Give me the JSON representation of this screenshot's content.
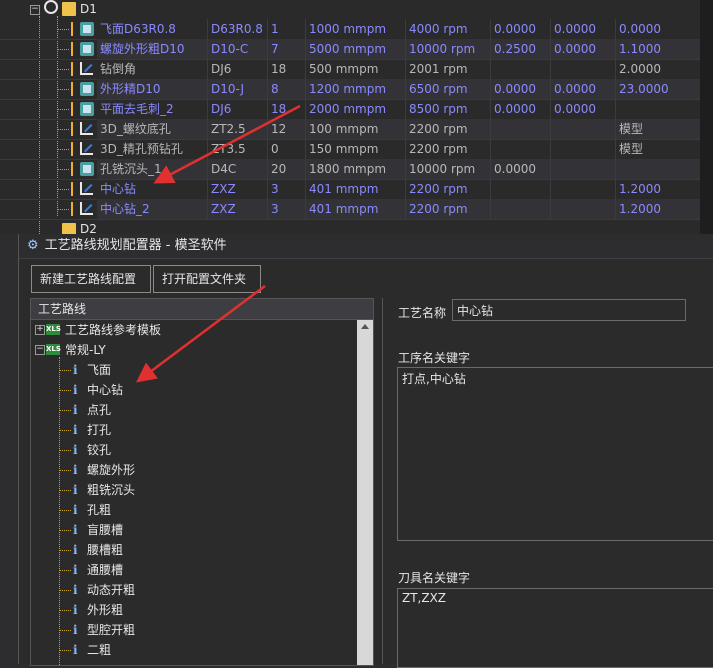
{
  "top": {
    "group_d1": "D1",
    "group_d2": "D2",
    "rows": [
      {
        "name": "飞面D63R0.8",
        "tool": "D63R0.8",
        "num": "1",
        "feed": "1000 mmpm",
        "speed": "4000 rpm",
        "v1": "0.0000",
        "v2": "0.0000",
        "v3": "0.0000",
        "style": "blue",
        "icon": "op"
      },
      {
        "name": "螺旋外形粗D10",
        "tool": "D10-C",
        "num": "7",
        "feed": "5000 mmpm",
        "speed": "10000 rpm",
        "v1": "0.2500",
        "v2": "0.0000",
        "v3": "1.1000",
        "style": "blue",
        "icon": "op"
      },
      {
        "name": "钻倒角",
        "tool": "DJ6",
        "num": "18",
        "feed": "500 mmpm",
        "speed": "2001 rpm",
        "v1": "",
        "v2": "",
        "v3": "2.0000",
        "style": "gray",
        "icon": "drill"
      },
      {
        "name": "外形精D10",
        "tool": "D10-J",
        "num": "8",
        "feed": "1200 mmpm",
        "speed": "6500 rpm",
        "v1": "0.0000",
        "v2": "0.0000",
        "v3": "23.0000",
        "style": "blue",
        "icon": "op"
      },
      {
        "name": "平面去毛刺_2",
        "tool": "DJ6",
        "num": "18",
        "feed": "2000 mmpm",
        "speed": "8500 rpm",
        "v1": "0.0000",
        "v2": "0.0000",
        "v3": "",
        "style": "blue",
        "icon": "op"
      },
      {
        "name": "3D_螺纹底孔",
        "tool": "ZT2.5",
        "num": "12",
        "feed": "100 mmpm",
        "speed": "2200 rpm",
        "v1": "",
        "v2": "",
        "v3": "模型",
        "style": "gray",
        "icon": "drill"
      },
      {
        "name": "3D_精孔预钻孔",
        "tool": "ZT3.5",
        "num": "0",
        "feed": "150 mmpm",
        "speed": "2200 rpm",
        "v1": "",
        "v2": "",
        "v3": "模型",
        "style": "gray",
        "icon": "drill"
      },
      {
        "name": "孔铣沉头_1",
        "tool": "D4C",
        "num": "20",
        "feed": "1800 mmpm",
        "speed": "10000 rpm",
        "v1": "0.0000",
        "v2": "",
        "v3": "",
        "style": "gray",
        "icon": "op2"
      },
      {
        "name": "中心钻",
        "tool": "ZXZ",
        "num": "3",
        "feed": "401 mmpm",
        "speed": "2200 rpm",
        "v1": "",
        "v2": "",
        "v3": "1.2000",
        "style": "blue",
        "icon": "drill"
      },
      {
        "name": "中心钻_2",
        "tool": "ZXZ",
        "num": "3",
        "feed": "401 mmpm",
        "speed": "2200 rpm",
        "v1": "",
        "v2": "",
        "v3": "1.2000",
        "style": "blue",
        "icon": "drill"
      }
    ]
  },
  "dialog": {
    "title": "工艺路线规划配置器 - 模圣软件",
    "btn_new": "新建工艺路线配置",
    "btn_open": "打开配置文件夹",
    "tree_header": "工艺路线",
    "tree_root1": "工艺路线参考模板",
    "tree_root2": "常规-LY",
    "tree_items": [
      "飞面",
      "中心钻",
      "点孔",
      "打孔",
      "铰孔",
      "螺旋外形",
      "粗铣沉头",
      "孔粗",
      "盲腰槽",
      "腰槽粗",
      "通腰槽",
      "动态开粗",
      "外形粗",
      "型腔开粗",
      "二粗"
    ],
    "label_name": "工艺名称",
    "value_name": "中心钻",
    "label_op_kw": "工序名关键字",
    "value_op_kw": "打点,中心钻",
    "label_tool_kw": "刀具名关键字",
    "value_tool_kw": "ZT,ZXZ"
  },
  "colors": {
    "accent_arrow": "#e03030",
    "folder": "#f0c14b",
    "op_blue": "#8a8aff"
  }
}
